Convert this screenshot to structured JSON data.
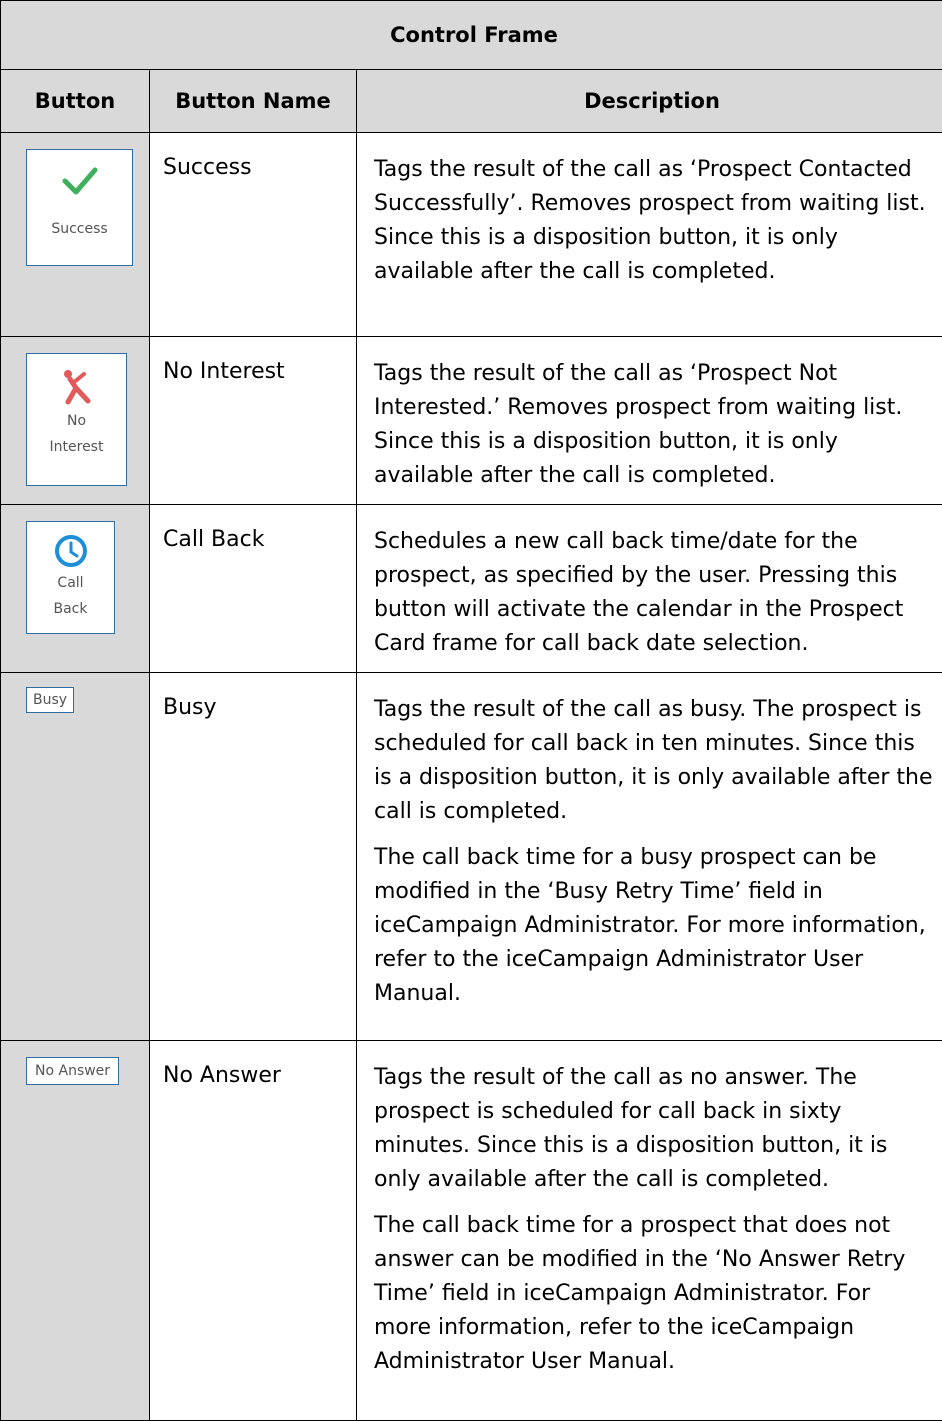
{
  "title": "Control Frame",
  "headers": {
    "button": "Button",
    "name": "Button Name",
    "description": "Description"
  },
  "rows": [
    {
      "button_label": "Success",
      "icon": "checkmark-icon",
      "icon_color": "#3eaf5c",
      "name": "Success",
      "description": [
        "Tags the result of the call as ‘Prospect Contacted Successfully’. Removes prospect from waiting list. Since this is a disposition button, it is only available after the call is completed."
      ]
    },
    {
      "button_label_1": "No",
      "button_label_2": "Interest",
      "icon": "falling-person-icon",
      "icon_color": "#e05a5a",
      "name": "No Interest",
      "description": [
        "Tags the result of the call as ‘Prospect Not Interested.’ Removes prospect from waiting list. Since this is a disposition button, it is only available after the call is completed."
      ]
    },
    {
      "button_label_1": "Call",
      "button_label_2": "Back",
      "icon": "clock-icon",
      "icon_color": "#1e8fd6",
      "name": "Call Back",
      "description": [
        "Schedules a new call back time/date for the prospect, as specified by the user. Pressing this button will activate the calendar in the Prospect Card frame for call back date selection."
      ]
    },
    {
      "button_label": "Busy",
      "name": "Busy",
      "description": [
        "Tags the result of the call as busy. The prospect is scheduled for call back in ten minutes. Since this is a disposition button, it is only available after the call is completed.",
        "The call back time for a busy prospect can be modified in the ‘Busy Retry Time’ field in iceCampaign Administrator. For more information, refer to the iceCampaign Administrator User Manual."
      ]
    },
    {
      "button_label": "No Answer",
      "name": "No Answer",
      "description": [
        "Tags the result of the call as no answer. The prospect is scheduled for call back in sixty minutes. Since this is a disposition button, it is only available after the call is completed.",
        "The call back time for a prospect that does not answer can be modified in the ‘No Answer Retry Time’ field in iceCampaign Administrator.  For more information, refer to the iceCampaign Administrator User Manual."
      ]
    }
  ]
}
